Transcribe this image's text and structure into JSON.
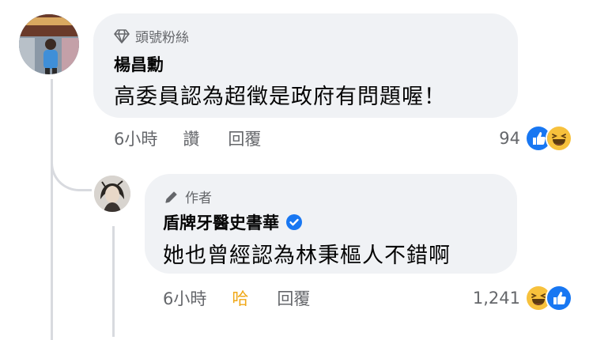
{
  "comment": {
    "badge": "頭號粉絲",
    "author": "楊昌勳",
    "text": "高委員認為超徵是政府有問題喔！",
    "time": "6小時",
    "actions": [
      "讚",
      "回覆"
    ],
    "reaction_count": "94",
    "reactions": [
      "like-icon",
      "haha-icon"
    ]
  },
  "reply": {
    "badge": "作者",
    "author": "盾牌牙醫史書華",
    "verified": true,
    "text": "她也曾經認為林秉樞人不錯啊",
    "time": "6小時",
    "actions": [
      "哈",
      "回覆"
    ],
    "reaction_count": "1,241",
    "reactions": [
      "haha-icon",
      "like-icon"
    ]
  },
  "colors": {
    "bubble": "#f0f2f5",
    "secondary_text": "#65676b",
    "like_blue": "#1877f2",
    "haha_yellow": "#f0a818",
    "verified_blue": "#1877f2"
  }
}
